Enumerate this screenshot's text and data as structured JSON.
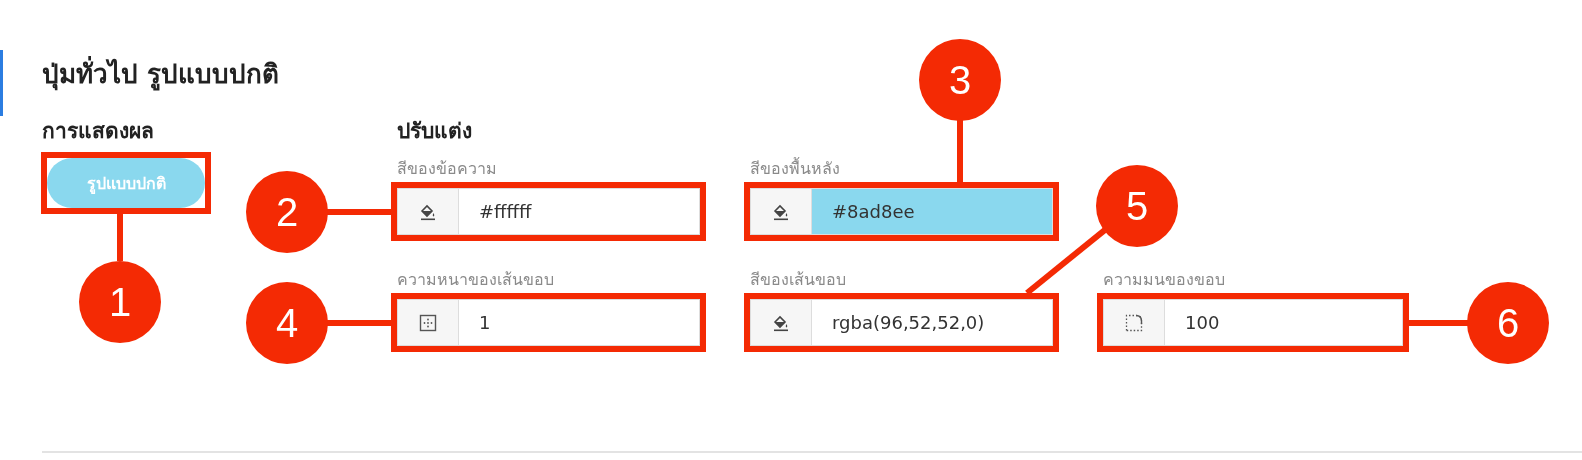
{
  "title": "ปุ่มทั่วไป รูปแบบปกติ",
  "preview": {
    "heading": "การแสดงผล",
    "button": {
      "label": "รูปแบบปกติ"
    },
    "callout": {
      "number": "1"
    }
  },
  "settings": {
    "heading": "ปรับแต่ง",
    "rows": [
      [
        {
          "label": "สีของข้อความ",
          "kind": "color",
          "value": "#ffffff",
          "callout": {
            "number": "2"
          }
        },
        {
          "label": "สีของพื้นหลัง",
          "kind": "color",
          "value": "#8ad8ee",
          "callout": {
            "number": "3"
          }
        }
      ],
      [
        {
          "label": "ความหนาของเส้นขอบ",
          "kind": "width",
          "value": "1",
          "callout": {
            "number": "4"
          }
        },
        {
          "label": "สีของเส้นขอบ",
          "kind": "color",
          "value": "rgba(96,52,52,0)",
          "callout": {
            "number": "5"
          }
        },
        {
          "label": "ความมนของขอบ",
          "kind": "radius",
          "value": "100",
          "callout": {
            "number": "6"
          }
        }
      ]
    ]
  }
}
